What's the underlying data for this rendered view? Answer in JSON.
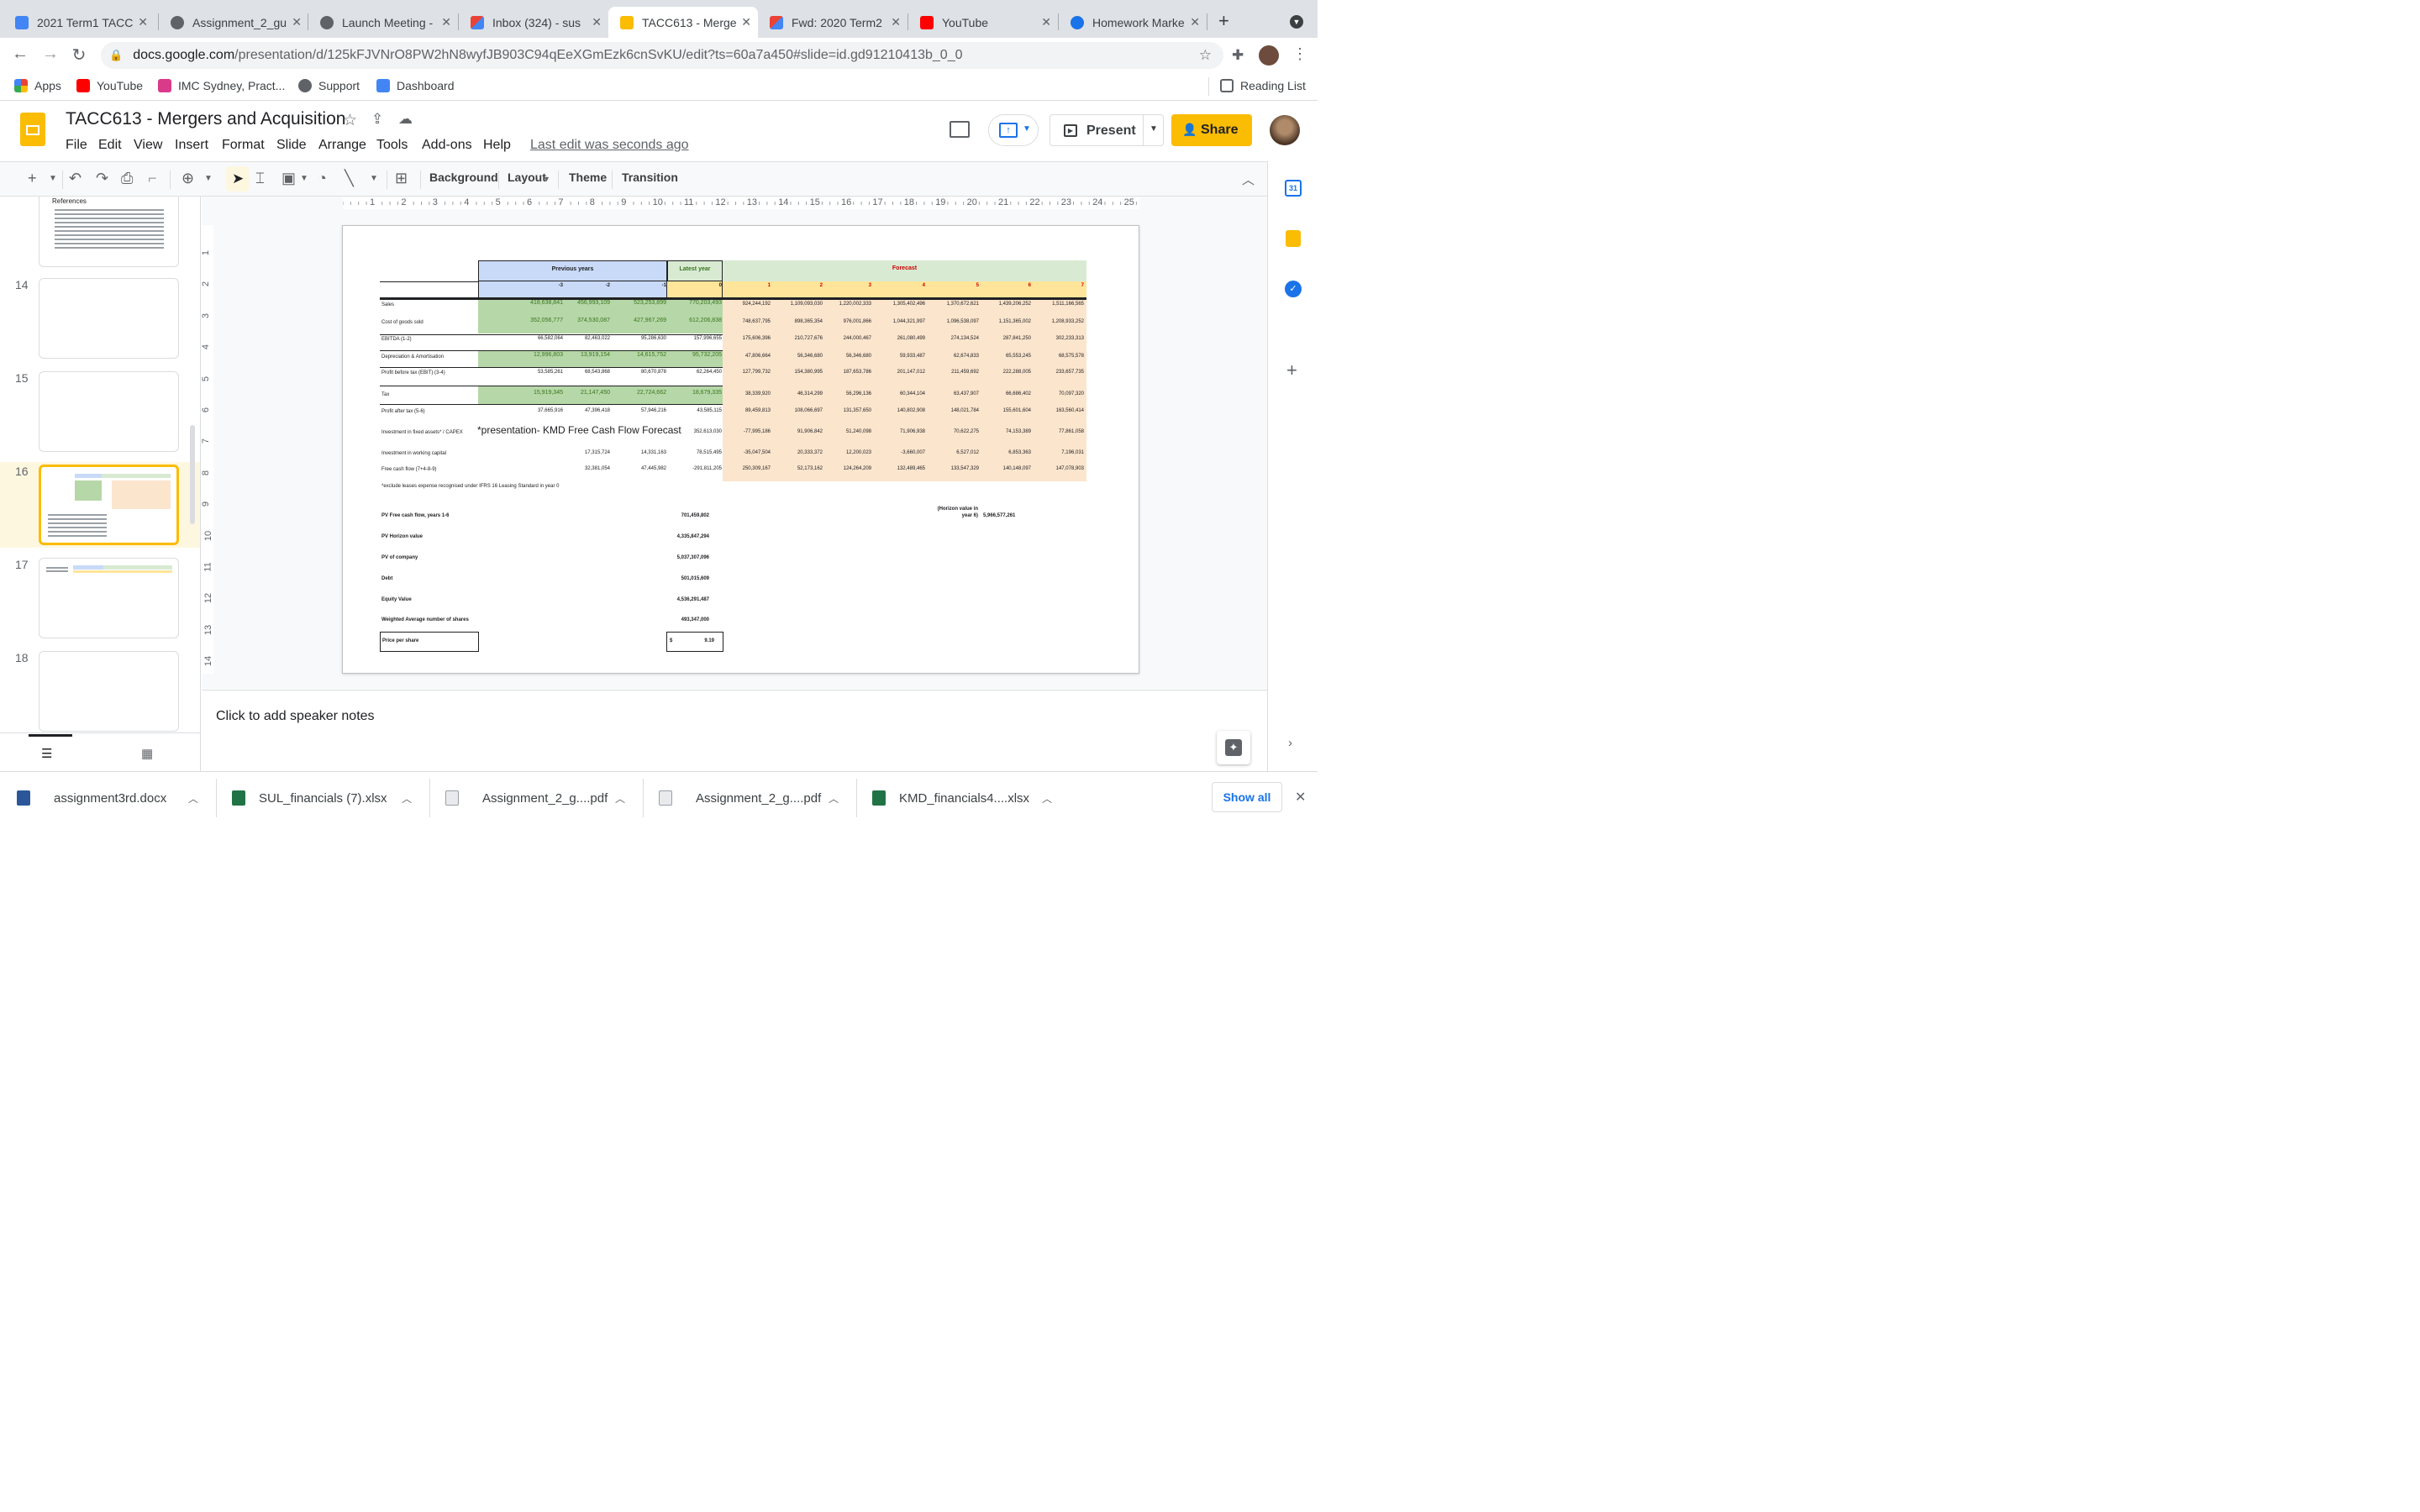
{
  "browser": {
    "tabs": [
      {
        "title": "2021 Term1 TACC",
        "color": "#4285f4"
      },
      {
        "title": "Assignment_2_gu",
        "color": "#5f6368"
      },
      {
        "title": "Launch Meeting -",
        "color": "#5f6368"
      },
      {
        "title": "Inbox (324) - sus",
        "color": "#ea4335"
      },
      {
        "title": "TACC613 - Merge",
        "color": "#fbbc04"
      },
      {
        "title": "Fwd: 2020 Term2",
        "color": "#ea4335"
      },
      {
        "title": "YouTube",
        "color": "#ff0000"
      },
      {
        "title": "Homework Marke",
        "color": "#1a73e8"
      }
    ],
    "url_host": "docs.google.com",
    "url_path": "/presentation/d/125kFJVNrO8PW2hN8wyfJB903C94qEeXGmEzk6cnSvKU/edit?ts=60a7a450#slide=id.gd91210413b_0_0",
    "bookmarks": [
      "Apps",
      "YouTube",
      "IMC Sydney, Pract...",
      "Support",
      "Dashboard"
    ],
    "reading_list": "Reading List"
  },
  "doc": {
    "title": "TACC613 - Mergers and Acquisition",
    "menus": [
      "File",
      "Edit",
      "View",
      "Insert",
      "Format",
      "Slide",
      "Arrange",
      "Tools",
      "Add-ons",
      "Help"
    ],
    "last_edit": "Last edit was seconds ago",
    "present": "Present",
    "share": "Share"
  },
  "toolbar": {
    "background": "Background",
    "layout": "Layout",
    "theme": "Theme",
    "transition": "Transition"
  },
  "filmstrip": {
    "references_title": "References",
    "slides": [
      "14",
      "15",
      "16",
      "17",
      "18"
    ]
  },
  "ruler": {
    "h": [
      "1",
      "2",
      "3",
      "4",
      "5",
      "6",
      "7",
      "8",
      "9",
      "10",
      "11",
      "12",
      "13",
      "14",
      "15",
      "16",
      "17",
      "18",
      "19",
      "20",
      "21",
      "22",
      "23",
      "24",
      "25"
    ],
    "v": [
      "1",
      "2",
      "3",
      "4",
      "5",
      "6",
      "7",
      "8",
      "9",
      "10",
      "11",
      "12",
      "13",
      "14"
    ]
  },
  "slide": {
    "header_prev": "Previous years",
    "header_latest": "Latest year",
    "header_forecast": "Forecast",
    "years": [
      "-3",
      "-2",
      "-1",
      "0",
      "1",
      "2",
      "3",
      "4",
      "5",
      "6",
      "7"
    ],
    "rows": [
      {
        "label": "Sales",
        "values": [
          "418,638,841",
          "456,993,109",
          "523,253,899",
          "770,203,493",
          "924,244,192",
          "1,109,093,030",
          "1,220,002,333",
          "1,305,402,496",
          "1,370,672,621",
          "1,439,206,252",
          "1,511,166,565"
        ]
      },
      {
        "label": "Cost of goods sold",
        "values": [
          "352,056,777",
          "374,530,087",
          "427,967,269",
          "612,206,838",
          "748,637,795",
          "898,365,354",
          "976,001,866",
          "1,044,321,997",
          "1,096,538,097",
          "1,151,365,002",
          "1,208,933,252"
        ]
      },
      {
        "label": "EBITDA (1-2)",
        "values": [
          "66,582,064",
          "82,463,022",
          "95,286,630",
          "157,996,655",
          "175,606,396",
          "210,727,676",
          "244,000,467",
          "261,080,499",
          "274,134,524",
          "287,841,250",
          "302,233,313"
        ]
      },
      {
        "label": "Depreciation & Amortisation",
        "values": [
          "12,996,803",
          "13,919,154",
          "14,615,752",
          "95,732,205",
          "47,806,664",
          "56,346,680",
          "56,346,680",
          "59,933,487",
          "62,674,833",
          "65,553,245",
          "68,575,578"
        ]
      },
      {
        "label": "Profit before tax (EBIT) (3-4)",
        "values": [
          "53,585,261",
          "68,543,868",
          "80,670,878",
          "62,264,450",
          "127,799,732",
          "154,380,995",
          "187,653,786",
          "201,147,012",
          "211,459,692",
          "222,288,005",
          "233,657,735"
        ]
      },
      {
        "label": "Tax",
        "values": [
          "15,919,345",
          "21,147,450",
          "22,724,662",
          "18,679,335",
          "38,339,920",
          "46,314,299",
          "56,296,136",
          "60,344,104",
          "63,437,907",
          "66,686,402",
          "70,097,320"
        ]
      },
      {
        "label": "Profit after tax (5-6)",
        "values": [
          "37,665,916",
          "47,396,418",
          "57,946,216",
          "43,585,115",
          "89,459,813",
          "108,066,697",
          "131,357,650",
          "140,802,908",
          "148,021,784",
          "155,601,604",
          "163,560,414"
        ]
      },
      {
        "label": "Investment in fixed assets* / CAPEX",
        "values": [
          "",
          "",
          "",
          "352,613,030",
          "-77,995,186",
          "91,906,842",
          "51,240,098",
          "71,906,938",
          "70,622,275",
          "74,153,389",
          "77,861,058"
        ]
      },
      {
        "label": "Investment in working capital",
        "values": [
          "",
          "17,315,724",
          "14,331,163",
          "78,515,495",
          "-35,047,504",
          "20,333,372",
          "12,200,023",
          "-3,660,007",
          "6,527,012",
          "6,853,363",
          "7,196,031"
        ]
      },
      {
        "label": "Free cash flow (7+4-8-9)",
        "values": [
          "",
          "32,381,054",
          "47,445,982",
          "-291,811,205",
          "250,309,167",
          "52,173,162",
          "124,264,209",
          "132,489,465",
          "133,547,329",
          "140,148,097",
          "147,078,903"
        ]
      }
    ],
    "overlay_text": "*presentation- KMD Free Cash Flow Forecast",
    "footnote": "*exclude leases expense recognised under IFRS 16 Leasing Standard in year 0",
    "horizon_label": "(Horizon value in year 6)",
    "horizon_value": "5,966,577,261",
    "summary": [
      {
        "label": "PV Free cash flow, years 1-6",
        "value": "701,459,802"
      },
      {
        "label": "PV Horizon value",
        "value": "4,335,847,294"
      },
      {
        "label": "PV of company",
        "value": "5,037,307,096"
      },
      {
        "label": "Debt",
        "value": "501,015,609"
      },
      {
        "label": "Equity Value",
        "value": "4,536,291,487"
      },
      {
        "label": "Weighted Average number of shares",
        "value": "493,347,000"
      }
    ],
    "price_label": "Price per share",
    "price_currency": "$",
    "price_value": "9.19"
  },
  "notes": {
    "placeholder": "Click to add speaker notes"
  },
  "downloads": {
    "items": [
      "assignment3rd.docx",
      "SUL_financials (7).xlsx",
      "Assignment_2_g....pdf",
      "Assignment_2_g....pdf",
      "KMD_financials4....xlsx"
    ],
    "show_all": "Show all"
  }
}
